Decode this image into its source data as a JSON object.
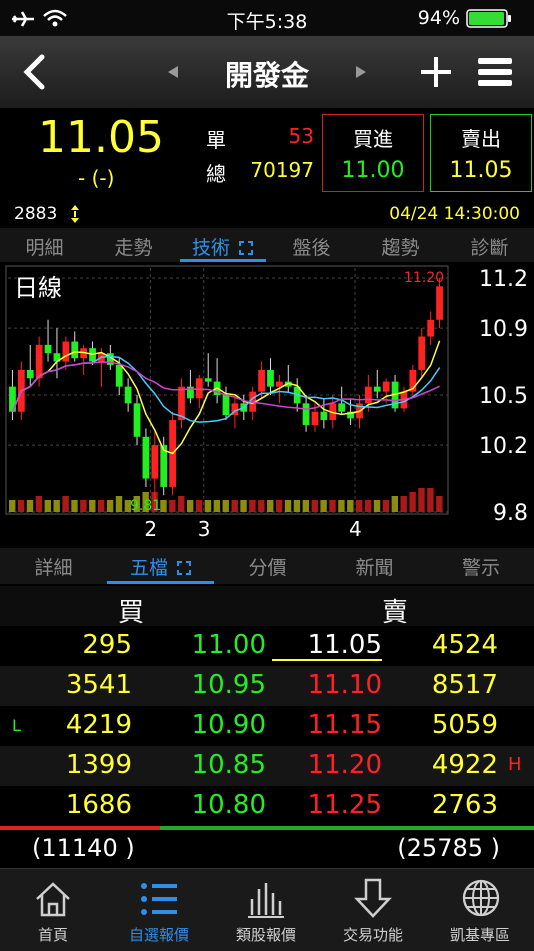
{
  "status": {
    "time": "下午5:38",
    "battery": "94%"
  },
  "nav": {
    "title": "開發金"
  },
  "quote": {
    "price": "11.05",
    "change": "- (-)",
    "single_label": "單",
    "single_value": "53",
    "total_label": "總",
    "total_value": "70197",
    "buy_label": "買進",
    "buy_price": "11.00",
    "sell_label": "賣出",
    "sell_price": "11.05",
    "code": "2883",
    "datetime": "04/24 14:30:00"
  },
  "tabs_top": [
    "明細",
    "走勢",
    "技術",
    "盤後",
    "趨勢",
    "診斷"
  ],
  "tabs_top_active": 2,
  "chart_data": {
    "type": "candlestick",
    "title": "日線",
    "ylim": [
      9.8,
      11.2
    ],
    "yticks": [
      "11.2",
      "10.9",
      "10.5",
      "10.2",
      "9.8"
    ],
    "xticks": [
      "2",
      "3",
      "4"
    ],
    "annotations": {
      "high": "11.20",
      "low": "9.81"
    },
    "colors": {
      "up": "#ff2222",
      "down": "#22ee22",
      "ma1": "#ffff44",
      "ma2": "#44ccff",
      "ma3": "#cc44cc"
    },
    "candles": [
      [
        10.55,
        10.65,
        10.35,
        10.4
      ],
      [
        10.4,
        10.7,
        10.35,
        10.65
      ],
      [
        10.65,
        10.8,
        10.55,
        10.6
      ],
      [
        10.6,
        10.85,
        10.55,
        10.8
      ],
      [
        10.8,
        10.95,
        10.7,
        10.75
      ],
      [
        10.75,
        10.9,
        10.6,
        10.7
      ],
      [
        10.7,
        10.85,
        10.65,
        10.82
      ],
      [
        10.82,
        10.88,
        10.7,
        10.72
      ],
      [
        10.72,
        10.8,
        10.62,
        10.78
      ],
      [
        10.78,
        10.82,
        10.68,
        10.7
      ],
      [
        10.7,
        10.78,
        10.55,
        10.75
      ],
      [
        10.75,
        10.8,
        10.65,
        10.68
      ],
      [
        10.68,
        10.72,
        10.5,
        10.55
      ],
      [
        10.55,
        10.6,
        10.4,
        10.45
      ],
      [
        10.45,
        10.5,
        10.2,
        10.25
      ],
      [
        10.25,
        10.3,
        9.95,
        10.0
      ],
      [
        10.0,
        10.28,
        9.81,
        10.2
      ],
      [
        10.2,
        10.25,
        9.9,
        9.95
      ],
      [
        9.95,
        10.4,
        9.9,
        10.35
      ],
      [
        10.35,
        10.6,
        10.3,
        10.55
      ],
      [
        10.55,
        10.65,
        10.45,
        10.48
      ],
      [
        10.48,
        10.62,
        10.42,
        10.6
      ],
      [
        10.6,
        10.75,
        10.55,
        10.58
      ],
      [
        10.58,
        10.72,
        10.45,
        10.5
      ],
      [
        10.5,
        10.55,
        10.35,
        10.38
      ],
      [
        10.38,
        10.5,
        10.3,
        10.45
      ],
      [
        10.45,
        10.5,
        10.35,
        10.4
      ],
      [
        10.4,
        10.55,
        10.35,
        10.52
      ],
      [
        10.52,
        10.7,
        10.48,
        10.65
      ],
      [
        10.65,
        10.72,
        10.5,
        10.55
      ],
      [
        10.55,
        10.62,
        10.45,
        10.58
      ],
      [
        10.58,
        10.68,
        10.52,
        10.55
      ],
      [
        10.55,
        10.6,
        10.4,
        10.45
      ],
      [
        10.45,
        10.5,
        10.28,
        10.32
      ],
      [
        10.32,
        10.45,
        10.28,
        10.4
      ],
      [
        10.4,
        10.48,
        10.3,
        10.35
      ],
      [
        10.35,
        10.5,
        10.3,
        10.45
      ],
      [
        10.45,
        10.55,
        10.38,
        10.4
      ],
      [
        10.4,
        10.48,
        10.32,
        10.36
      ],
      [
        10.36,
        10.5,
        10.3,
        10.45
      ],
      [
        10.45,
        10.62,
        10.4,
        10.55
      ],
      [
        10.55,
        10.65,
        10.48,
        10.52
      ],
      [
        10.52,
        10.6,
        10.45,
        10.58
      ],
      [
        10.58,
        10.62,
        10.4,
        10.42
      ],
      [
        10.42,
        10.55,
        10.4,
        10.52
      ],
      [
        10.52,
        10.68,
        10.5,
        10.65
      ],
      [
        10.65,
        10.9,
        10.6,
        10.85
      ],
      [
        10.85,
        11.0,
        10.8,
        10.95
      ],
      [
        10.95,
        11.2,
        10.9,
        11.15
      ]
    ],
    "volume": [
      3,
      3,
      3,
      4,
      3,
      3,
      4,
      3,
      3,
      3,
      3,
      3,
      4,
      3,
      4,
      5,
      5,
      3,
      3,
      4,
      3,
      3,
      3,
      3,
      3,
      3,
      3,
      3,
      3,
      3,
      3,
      3,
      3,
      3,
      3,
      3,
      3,
      3,
      3,
      3,
      3,
      3,
      3,
      4,
      4,
      5,
      6,
      6,
      4
    ]
  },
  "tabs_mid": [
    "詳細",
    "五檔",
    "分價",
    "新聞",
    "警示"
  ],
  "tabs_mid_active": 1,
  "book": {
    "buy_header": "買",
    "sell_header": "賣",
    "rows": [
      {
        "bid_qty": "295",
        "bid": "11.00",
        "ask": "11.05",
        "ask_qty": "4524",
        "left_flag": "",
        "right_flag": ""
      },
      {
        "bid_qty": "3541",
        "bid": "10.95",
        "ask": "11.10",
        "ask_qty": "8517",
        "left_flag": "",
        "right_flag": ""
      },
      {
        "bid_qty": "4219",
        "bid": "10.90",
        "ask": "11.15",
        "ask_qty": "5059",
        "left_flag": "L",
        "right_flag": ""
      },
      {
        "bid_qty": "1399",
        "bid": "10.85",
        "ask": "11.20",
        "ask_qty": "4922",
        "left_flag": "",
        "right_flag": "H"
      },
      {
        "bid_qty": "1686",
        "bid": "10.80",
        "ask": "11.25",
        "ask_qty": "2763",
        "left_flag": "",
        "right_flag": ""
      }
    ],
    "bid_total": "(11140 )",
    "ask_total": "(25785 )",
    "ratio_buy": 0.3
  },
  "tabbar": [
    {
      "label": "首頁",
      "icon": "home-icon"
    },
    {
      "label": "自選報價",
      "icon": "list-icon"
    },
    {
      "label": "類股報價",
      "icon": "bar-chart-icon"
    },
    {
      "label": "交易功能",
      "icon": "trade-arrow-icon"
    },
    {
      "label": "凱基專區",
      "icon": "globe-icon"
    }
  ],
  "tabbar_active": 1
}
